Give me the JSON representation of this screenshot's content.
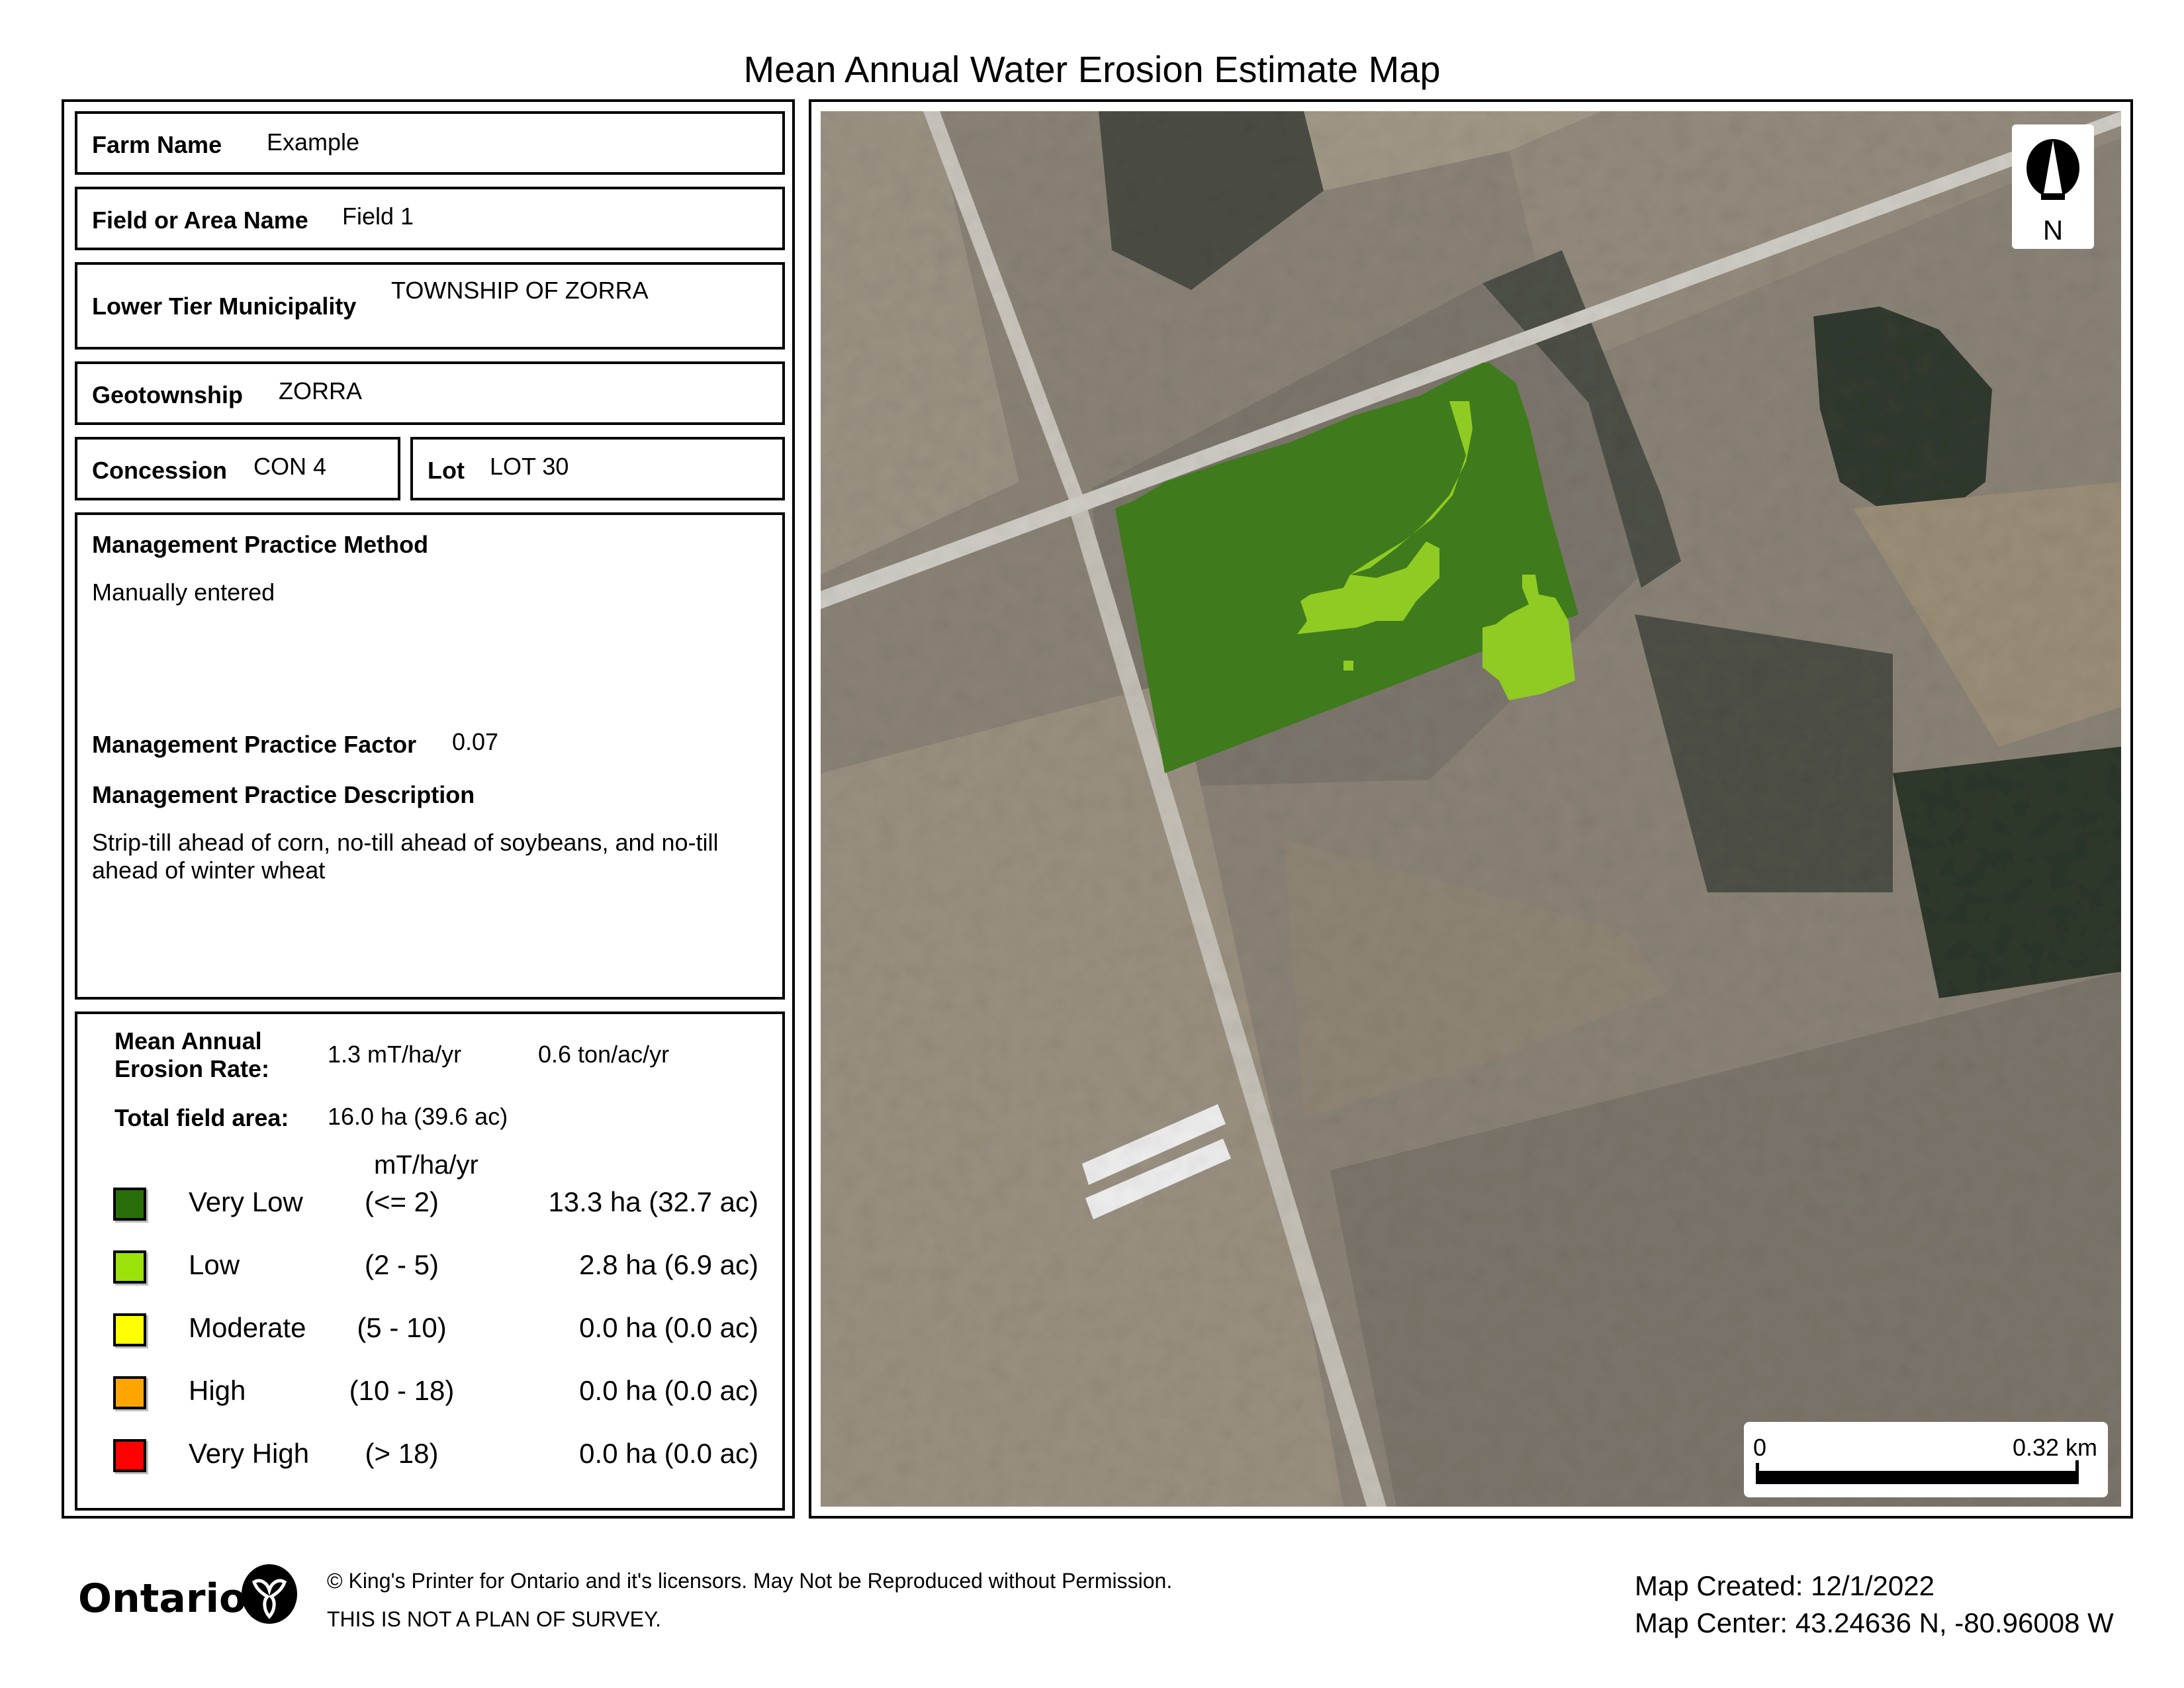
{
  "title": "Mean Annual Water Erosion Estimate Map",
  "info": {
    "farm_name_label": "Farm Name",
    "farm_name": "Example",
    "field_label": "Field or Area Name",
    "field": "Field 1",
    "municipality_label": "Lower Tier Municipality",
    "municipality": "TOWNSHIP OF ZORRA",
    "geotownship_label": "Geotownship",
    "geotownship": "ZORRA",
    "concession_label": "Concession",
    "concession": "CON 4",
    "lot_label": "Lot",
    "lot": "LOT 30"
  },
  "management": {
    "method_label": "Management Practice Method",
    "method": "Manually entered",
    "factor_label": "Management Practice Factor",
    "factor": "0.07",
    "description_label": "Management Practice Description",
    "description": "Strip-till ahead of corn, no-till ahead of soybeans, and no-till ahead of winter wheat"
  },
  "summary": {
    "rate_label_line1": "Mean Annual",
    "rate_label_line2": "Erosion Rate:",
    "rate_metric": "1.3 mT/ha/yr",
    "rate_imperial": "0.6 ton/ac/yr",
    "area_label": "Total field area:",
    "area": "16.0 ha (39.6 ac)",
    "units_header": "mT/ha/yr"
  },
  "legend": [
    {
      "class": "Very Low",
      "range": "(<= 2)",
      "area": "13.3 ha (32.7 ac)",
      "color": "#2a6e0a"
    },
    {
      "class": "Low",
      "range": "(2 - 5)",
      "area": "2.8 ha (6.9 ac)",
      "color": "#9be20a"
    },
    {
      "class": "Moderate",
      "range": "(5 - 10)",
      "area": "0.0 ha (0.0 ac)",
      "color": "#ffff00"
    },
    {
      "class": "High",
      "range": "(10 - 18)",
      "area": "0.0 ha (0.0 ac)",
      "color": "#ffa500"
    },
    {
      "class": "Very High",
      "range": "(> 18)",
      "area": "0.0 ha (0.0 ac)",
      "color": "#ff0000"
    }
  ],
  "map": {
    "north_label": "N",
    "scale_start": "0",
    "scale_end": "0.32 km",
    "overlay_very_low_color": "#3f7a1c",
    "overlay_low_color": "#8fcb22"
  },
  "footer": {
    "brand": "Ontario",
    "copyright": "© King's Printer for Ontario and it's licensors. May Not be Reproduced without Permission.",
    "disclaimer": "THIS IS NOT A PLAN OF SURVEY.",
    "map_created": "Map Created: 12/1/2022",
    "map_center": "Map Center: 43.24636 N, -80.96008 W"
  }
}
